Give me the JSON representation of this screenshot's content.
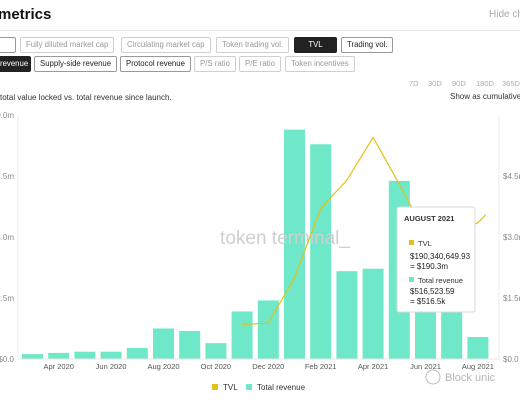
{
  "page": {
    "title": "metrics",
    "hide_label": "Hide ch",
    "description": "total value locked vs. total revenue since launch.",
    "cumulative_label": "Show as cumulative"
  },
  "tabs_row1": [
    {
      "label": "",
      "state": "on"
    },
    {
      "label": "Fully diluted market cap",
      "state": "off"
    },
    {
      "label": "Circulating market cap",
      "state": "off"
    },
    {
      "label": "Token trading vol.",
      "state": "off"
    },
    {
      "label": "TVL",
      "state": "selected"
    },
    {
      "label": "Trading vol.",
      "state": "on"
    }
  ],
  "tabs_row2": [
    {
      "label": "revenue",
      "state": "selected"
    },
    {
      "label": "Supply-side revenue",
      "state": "on"
    },
    {
      "label": "Protocol revenue",
      "state": "on"
    },
    {
      "label": "P/S ratio",
      "state": "off"
    },
    {
      "label": "P/E ratio",
      "state": "off"
    },
    {
      "label": "Token incentives",
      "state": "off"
    }
  ],
  "ranges": [
    "7D",
    "30D",
    "90D",
    "180D",
    "365D"
  ],
  "watermark": "token terminal_",
  "tooltip": {
    "title": "AUGUST 2021",
    "tvl_label": "TVL",
    "tvl_value": "$190,340,649.93",
    "tvl_short": "= $190.3m",
    "rev_label": "Total revenue",
    "rev_value": "$516,523.59",
    "rev_short": "= $516.5k"
  },
  "credit": "Block unic",
  "colors": {
    "bar": "#6ee8c8",
    "line": "#e0c21c",
    "selected": "#222222"
  },
  "chart_data": {
    "type": "bar",
    "title": "",
    "x_tick_labels": [
      "Apr 2020",
      "Jun 2020",
      "Aug 2020",
      "Oct 2020",
      "Dec 2020",
      "Feb 2021",
      "Apr 2021",
      "Jun 2021",
      "Aug 2021"
    ],
    "categories": [
      "Mar 2020",
      "Apr 2020",
      "May 2020",
      "Jun 2020",
      "Jul 2020",
      "Aug 2020",
      "Sep 2020",
      "Oct 2020",
      "Nov 2020",
      "Dec 2020",
      "Jan 2021",
      "Feb 2021",
      "Mar 2021",
      "Apr 2021",
      "May 2021",
      "Jun 2021",
      "Jul 2021",
      "Aug 2021"
    ],
    "left_axis": {
      "label": "Total revenue",
      "ticks": [
        "$0.0",
        "2.5m",
        "5.0m",
        "7.5m",
        "10.0m"
      ],
      "range": [
        0,
        10
      ]
    },
    "right_axis": {
      "label": "TVL",
      "ticks": [
        "$0.0",
        "$1.5m",
        "$3.0m",
        "$4.5m"
      ],
      "range": [
        0,
        6
      ]
    },
    "legend": {
      "position": "bottom-center",
      "items": [
        "TVL",
        "Total revenue"
      ]
    },
    "series": [
      {
        "name": "Total revenue",
        "type": "bar",
        "axis": "left",
        "values": [
          0.2,
          0.25,
          0.3,
          0.3,
          0.45,
          1.25,
          1.15,
          0.65,
          1.95,
          2.4,
          9.4,
          8.8,
          3.6,
          3.7,
          7.3,
          3.55,
          2.35,
          0.9
        ]
      },
      {
        "name": "TVL",
        "type": "line",
        "axis": "right",
        "values": [
          null,
          null,
          null,
          null,
          null,
          null,
          null,
          null,
          0.85,
          0.88,
          2.0,
          3.7,
          4.4,
          5.45,
          4.3,
          3.1,
          3.1,
          3.35
        ]
      }
    ],
    "grid": false
  }
}
